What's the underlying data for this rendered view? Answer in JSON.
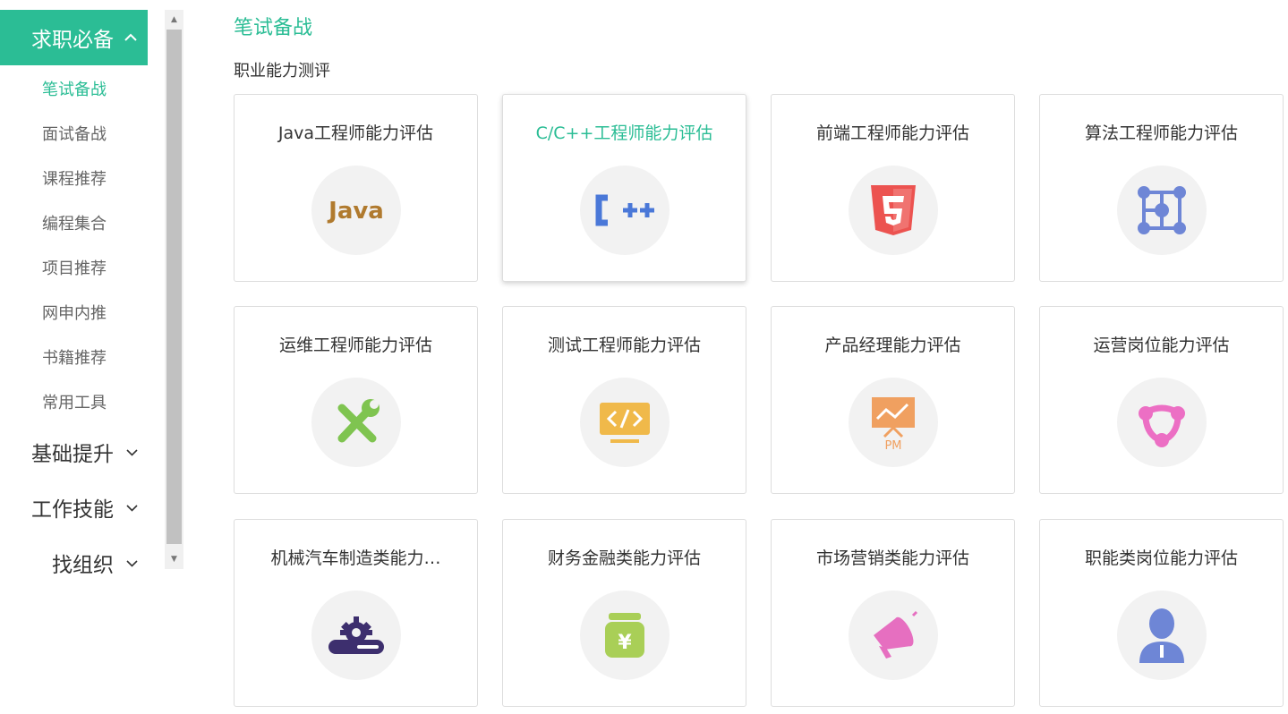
{
  "sidebar": {
    "active_group": "求职必备",
    "sub_items": [
      {
        "label": "笔试备战",
        "active": true
      },
      {
        "label": "面试备战",
        "active": false
      },
      {
        "label": "课程推荐",
        "active": false
      },
      {
        "label": "编程集合",
        "active": false
      },
      {
        "label": "项目推荐",
        "active": false
      },
      {
        "label": "网申内推",
        "active": false
      },
      {
        "label": "书籍推荐",
        "active": false
      },
      {
        "label": "常用工具",
        "active": false
      }
    ],
    "groups": [
      "基础提升",
      "工作技能",
      "找组织"
    ]
  },
  "main": {
    "title": "笔试备战",
    "section": "职业能力测评",
    "cards": [
      {
        "label": "Java工程师能力评估",
        "icon": "java-icon",
        "color": "#b07a2e"
      },
      {
        "label": "C/C++工程师能力评估",
        "icon": "cpp-icon",
        "color": "#4a78d8"
      },
      {
        "label": "前端工程师能力评估",
        "icon": "html5-icon",
        "color": "#ec5350"
      },
      {
        "label": "算法工程师能力评估",
        "icon": "algorithm-icon",
        "color": "#6e86d6"
      },
      {
        "label": "运维工程师能力评估",
        "icon": "wrench-icon",
        "color": "#7fc450"
      },
      {
        "label": "测试工程师能力评估",
        "icon": "code-monitor-icon",
        "color": "#f0b94a"
      },
      {
        "label": "产品经理能力评估",
        "icon": "pm-board-icon",
        "color": "#f0a060"
      },
      {
        "label": "运营岗位能力评估",
        "icon": "network-icon",
        "color": "#ec6fc4"
      },
      {
        "label": "机械汽车制造类能力…",
        "icon": "gear-icon",
        "color": "#3d2f6e"
      },
      {
        "label": "财务金融类能力评估",
        "icon": "money-icon",
        "color": "#a9cf57"
      },
      {
        "label": "市场营销类能力评估",
        "icon": "megaphone-icon",
        "color": "#e66fc0"
      },
      {
        "label": "职能类岗位能力评估",
        "icon": "person-icon",
        "color": "#6e86d6"
      }
    ]
  },
  "colors": {
    "accent": "#2bbd95"
  }
}
